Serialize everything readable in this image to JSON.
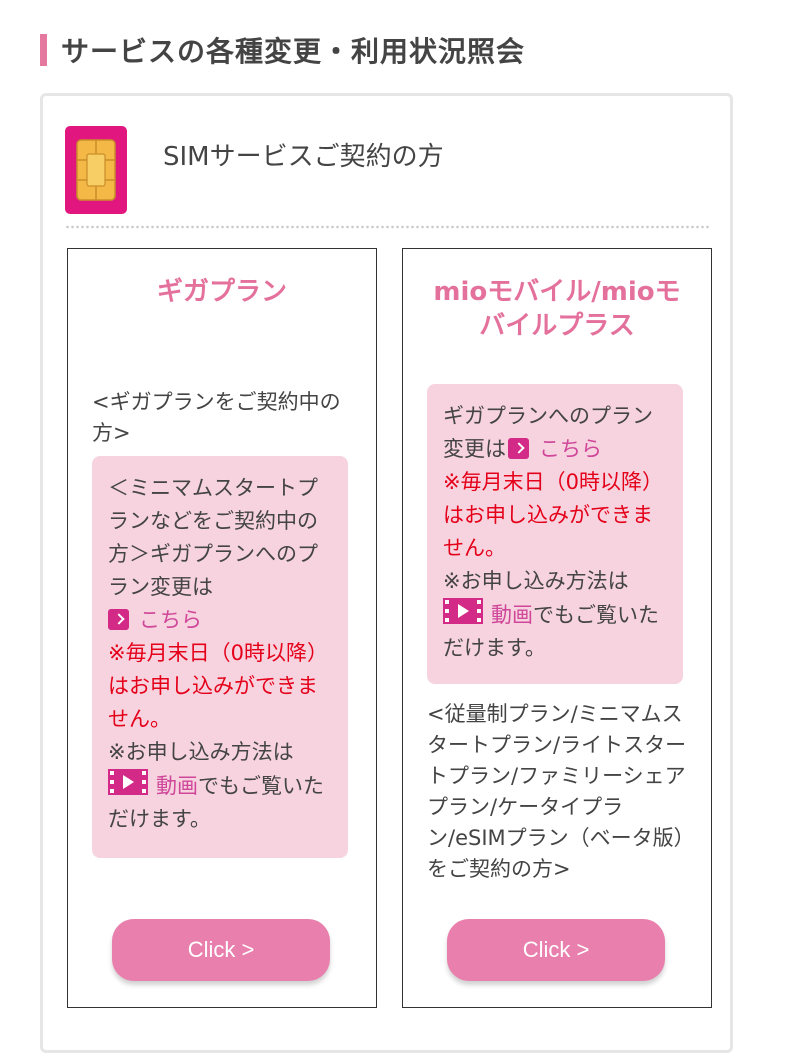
{
  "section": {
    "title": "サービスの各種変更・利用状況照会"
  },
  "card": {
    "title": "SIMサービスご契約の方",
    "icon": "sim-card-icon"
  },
  "columns": [
    {
      "title": "ギガプラン",
      "lead": "<ギガプランをご契約中の方>",
      "box": {
        "text1": "＜ミニマムスタートプランなどをご契約中の方＞ギガプランへのプラン変更は",
        "link1": "こちら",
        "warning": "※毎月末日（0時以降）はお申し込みができません。",
        "note_prefix": "※お申し込み方法は",
        "video_link": "動画",
        "note_suffix": "でもご覧いただけます。"
      },
      "button": "Click >"
    },
    {
      "title": "mioモバイル/mioモバイルプラス",
      "box": {
        "text1": "ギガプランへのプラン変更は",
        "link1": "こちら",
        "warning": "※毎月末日（0時以降）はお申し込みができません。",
        "note_prefix": "※お申し込み方法は",
        "video_link": "動画",
        "note_suffix": "でもご覧いただけます。"
      },
      "trail": "<従量制プラン/ミニマムスタートプラン/ライトスタートプラン/ファミリーシェアプラン/ケータイプラン/eSIMプラン（ベータ版）をご契約の方>",
      "button": "Click >"
    }
  ],
  "colors": {
    "accent": "#e4789f",
    "link": "#d0479a",
    "warning": "#e5001a",
    "box_bg": "#f6d3df",
    "button": "#e87fad"
  }
}
